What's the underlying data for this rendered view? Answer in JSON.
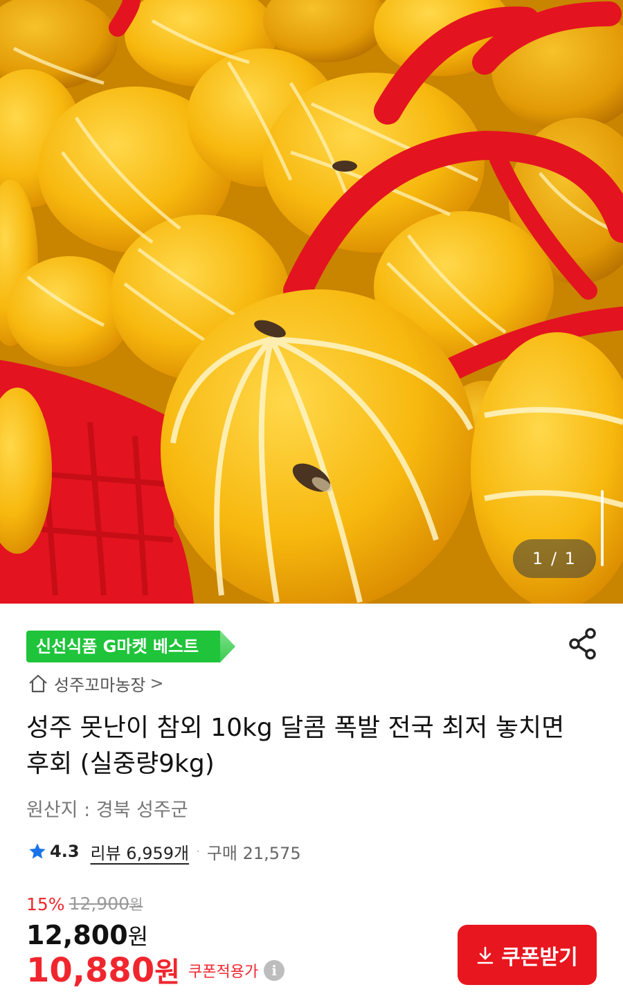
{
  "gallery": {
    "counter": "1 / 1",
    "image_alt": "yellow striped oriental melons in red baskets"
  },
  "badge": {
    "text": "신선식품 G마켓 베스트",
    "color": "#1fc43a"
  },
  "store": {
    "name": "성주꼬마농장",
    "chevron": ">"
  },
  "product": {
    "title": "성주 못난이 참외 10kg 달콤 폭발 전국 최저 놓치면 후회 (실중량9kg)",
    "origin": "원산지 : 경북 성주군"
  },
  "rating": {
    "score": "4.3",
    "reviews": "리뷰 6,959개",
    "separator": "·",
    "purchases": "구매 21,575"
  },
  "pricing": {
    "discount_rate": "15%",
    "original_price": "12,900",
    "original_unit": "원",
    "price": "12,800",
    "price_unit": "원",
    "coupon_price": "10,880",
    "coupon_unit": "원",
    "coupon_note": "쿠폰적용가"
  },
  "coupon_button": {
    "label": "쿠폰받기"
  },
  "colors": {
    "accent_red": "#e8161f",
    "sale_red": "#f0262e",
    "badge_green": "#1fc43a"
  }
}
